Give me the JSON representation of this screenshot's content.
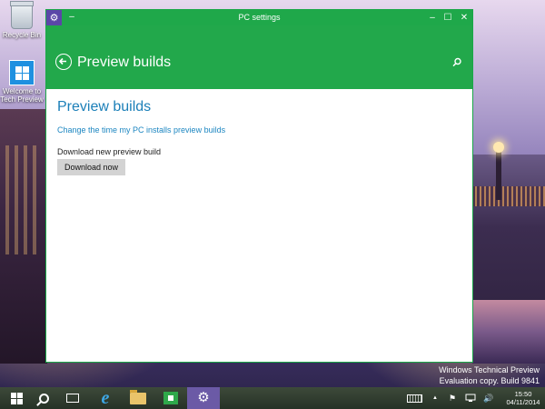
{
  "desktop": {
    "icons": [
      {
        "label": "Recycle Bin"
      },
      {
        "label": "Welcome to Tech Preview"
      }
    ],
    "watermark": {
      "line1": "Windows Technical Preview",
      "line2": "Evaluation copy. Build 9841"
    }
  },
  "window": {
    "title": "PC settings",
    "buttons": {
      "minimize": "–",
      "maximize": "☐",
      "close": "✕"
    },
    "header": {
      "title": "Preview builds"
    },
    "content": {
      "section_title": "Preview builds",
      "link_text": "Change the time my PC installs preview builds",
      "download_label": "Download new preview build",
      "download_button": "Download now"
    }
  },
  "taskbar": {
    "items": [
      {
        "icon": "start-icon"
      },
      {
        "icon": "search-icon"
      },
      {
        "icon": "task-view-icon"
      },
      {
        "icon": "internet-explorer-icon",
        "glyph": "e"
      },
      {
        "icon": "file-explorer-icon"
      },
      {
        "icon": "store-icon"
      },
      {
        "icon": "pc-settings-icon",
        "active": true
      }
    ],
    "tray": {
      "up_arrow": "▲",
      "flag": "⚑",
      "volume": "🔊"
    },
    "clock": {
      "time": "15:50",
      "date": "04/11/2014"
    }
  },
  "colors": {
    "accent_green": "#22a84b",
    "link_blue": "#1c86c1",
    "active_task": "#6b5aa6"
  }
}
